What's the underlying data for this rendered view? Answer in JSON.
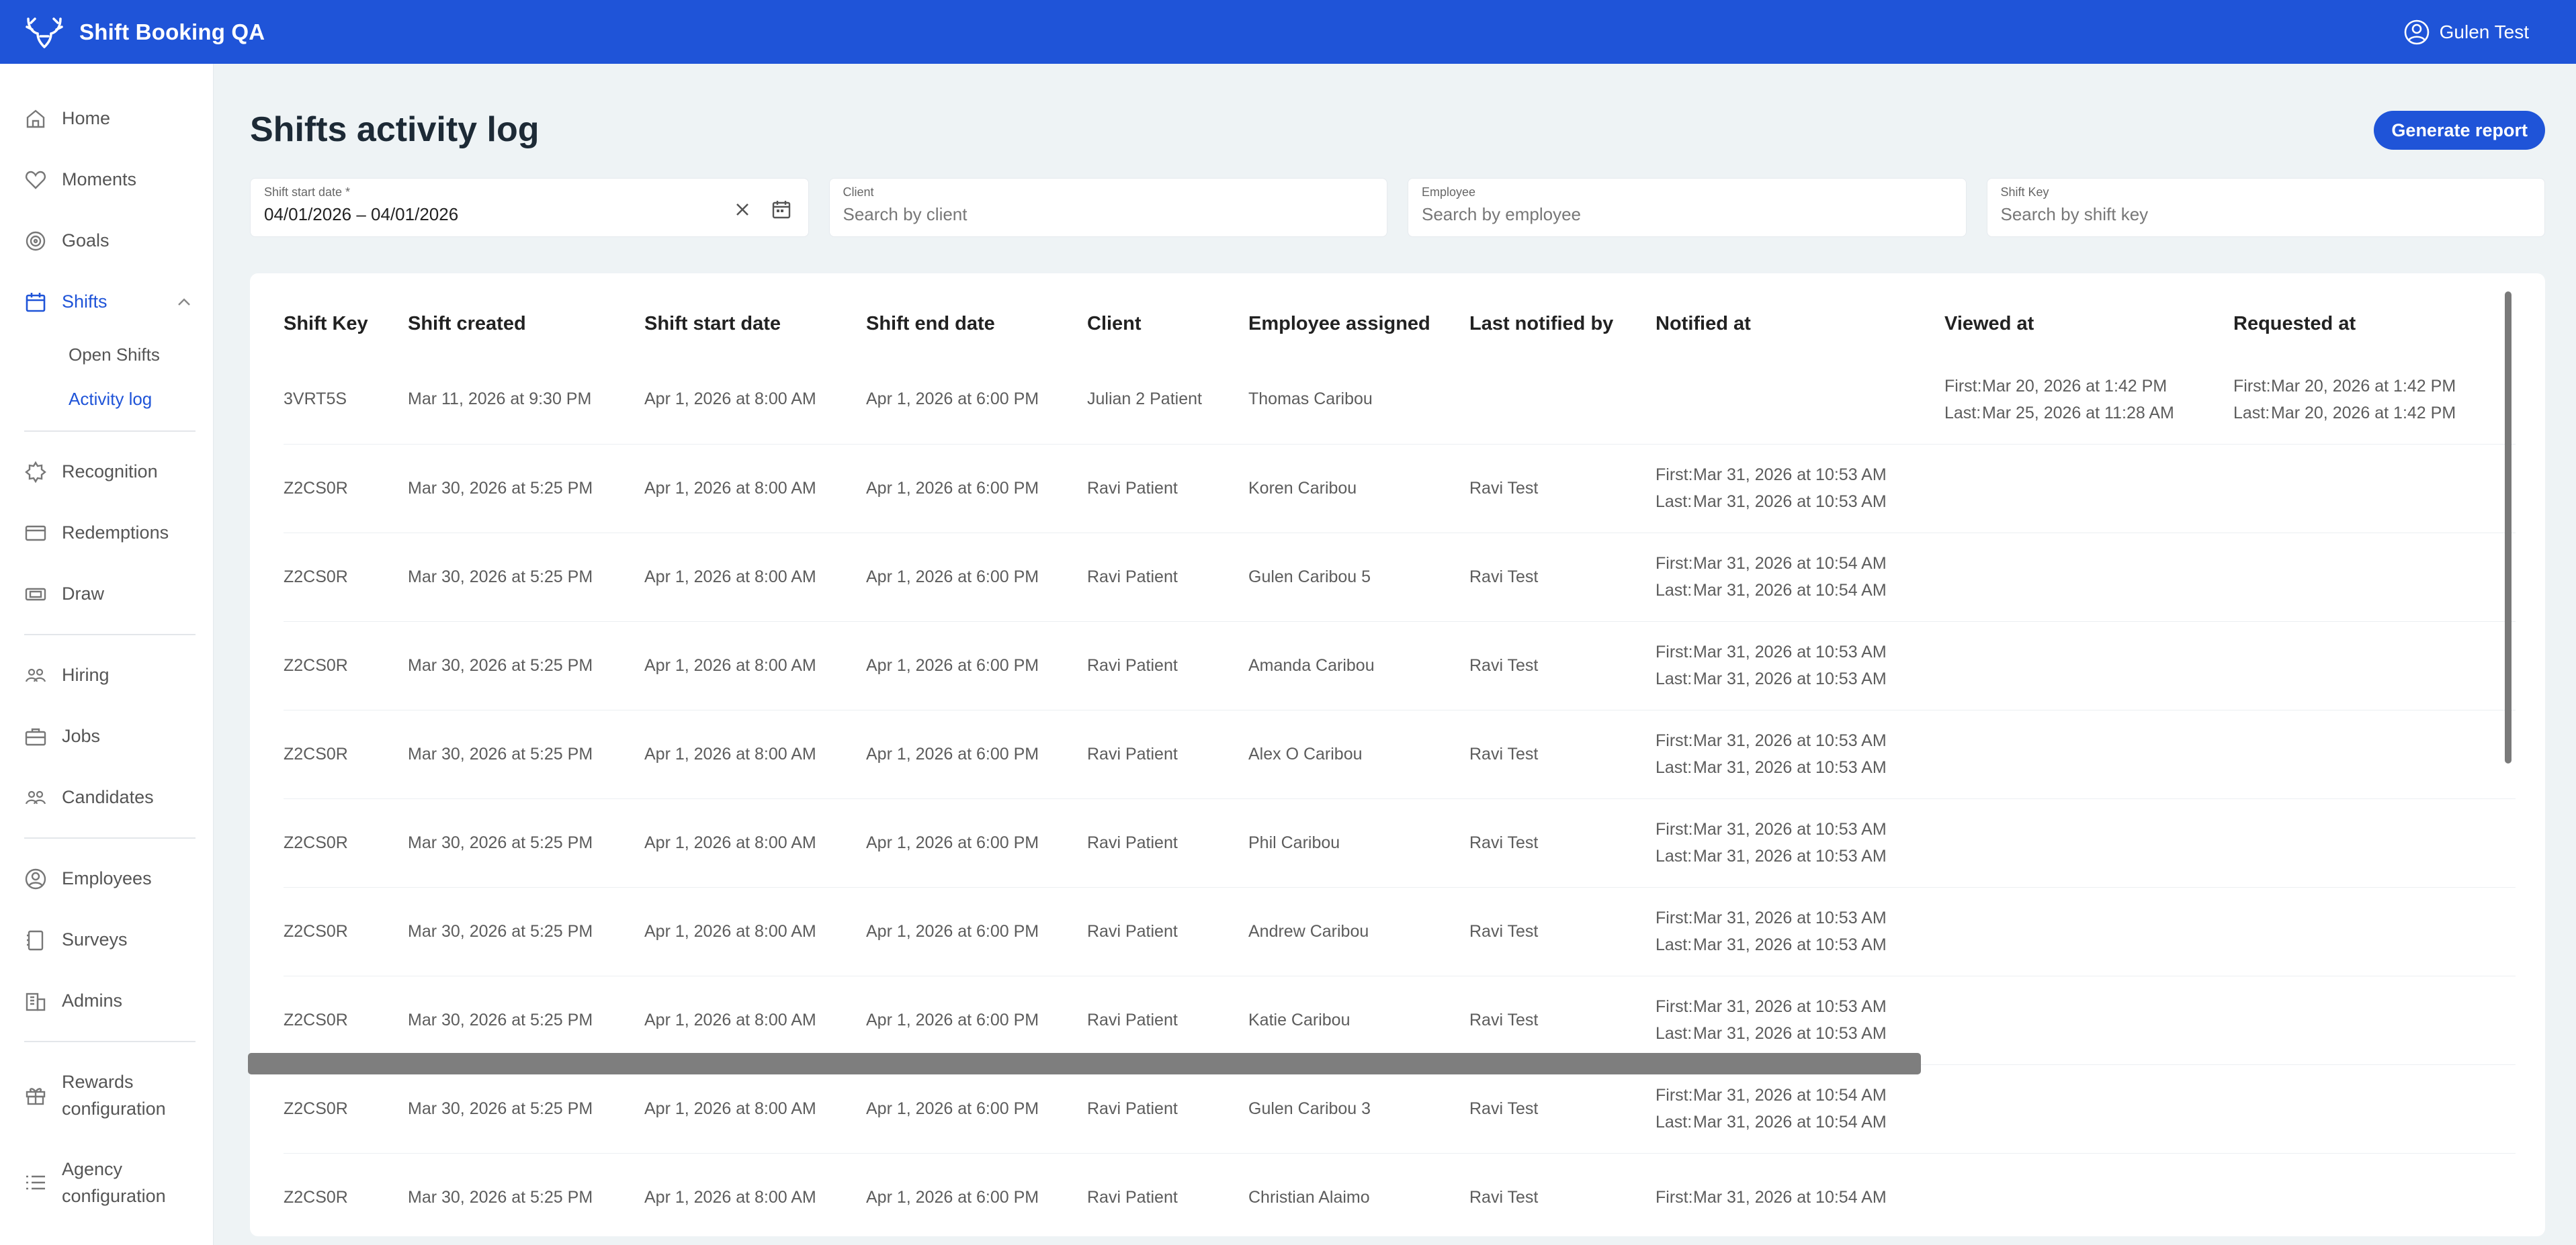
{
  "app": {
    "title": "Shift Booking QA",
    "user": "Gulen Test"
  },
  "sidebar": {
    "items": [
      {
        "label": "Home",
        "icon": "home-icon"
      },
      {
        "label": "Moments",
        "icon": "heart-icon"
      },
      {
        "label": "Goals",
        "icon": "target-icon"
      },
      {
        "label": "Shifts",
        "icon": "calendar-icon"
      },
      {
        "label": "Open Shifts"
      },
      {
        "label": "Activity log"
      },
      {
        "label": "Recognition",
        "icon": "badge-icon"
      },
      {
        "label": "Redemptions",
        "icon": "card-icon"
      },
      {
        "label": "Draw",
        "icon": "ticket-icon"
      },
      {
        "label": "Hiring",
        "icon": "people-icon"
      },
      {
        "label": "Jobs",
        "icon": "briefcase-icon"
      },
      {
        "label": "Candidates",
        "icon": "people-icon"
      },
      {
        "label": "Employees",
        "icon": "user-circle-icon"
      },
      {
        "label": "Surveys",
        "icon": "clipboard-icon"
      },
      {
        "label": "Admins",
        "icon": "building-icon"
      },
      {
        "label": "Rewards\nconfiguration",
        "icon": "gift-icon"
      },
      {
        "label": "Agency\nconfiguration",
        "icon": "list-icon"
      }
    ]
  },
  "page": {
    "title": "Shifts activity log",
    "generate_report": "Generate report"
  },
  "filters": {
    "date": {
      "label": "Shift start date *",
      "value": "04/01/2026 – 04/01/2026"
    },
    "client": {
      "label": "Client",
      "placeholder": "Search by client"
    },
    "employee": {
      "label": "Employee",
      "placeholder": "Search by employee"
    },
    "shift_key": {
      "label": "Shift Key",
      "placeholder": "Search by shift key"
    }
  },
  "table": {
    "columns": [
      "Shift Key",
      "Shift created",
      "Shift start date",
      "Shift end date",
      "Client",
      "Employee assigned",
      "Last notified by",
      "Notified at",
      "Viewed at",
      "Requested at"
    ],
    "first_label": "First:",
    "last_label": "Last:",
    "rows": [
      {
        "key": "3VRT5S",
        "created": "Mar 11, 2026 at 9:30 PM",
        "start": "Apr 1, 2026 at 8:00 AM",
        "end": "Apr 1, 2026 at 6:00 PM",
        "client": "Julian 2 Patient",
        "employee": "Thomas Caribou",
        "notified_by": "",
        "notified_first": "",
        "notified_last": "",
        "viewed_first": "Mar 20, 2026 at 1:42 PM",
        "viewed_last": "Mar 25, 2026 at 11:28 AM",
        "requested_first": "Mar 20, 2026 at 1:42 PM",
        "requested_last": "Mar 20, 2026 at 1:42 PM"
      },
      {
        "key": "Z2CS0R",
        "created": "Mar 30, 2026 at 5:25 PM",
        "start": "Apr 1, 2026 at 8:00 AM",
        "end": "Apr 1, 2026 at 6:00 PM",
        "client": "Ravi Patient",
        "employee": "Koren Caribou",
        "notified_by": "Ravi Test",
        "notified_first": "Mar 31, 2026 at 10:53 AM",
        "notified_last": "Mar 31, 2026 at 10:53 AM"
      },
      {
        "key": "Z2CS0R",
        "created": "Mar 30, 2026 at 5:25 PM",
        "start": "Apr 1, 2026 at 8:00 AM",
        "end": "Apr 1, 2026 at 6:00 PM",
        "client": "Ravi Patient",
        "employee": "Gulen Caribou 5",
        "notified_by": "Ravi Test",
        "notified_first": "Mar 31, 2026 at 10:54 AM",
        "notified_last": "Mar 31, 2026 at 10:54 AM"
      },
      {
        "key": "Z2CS0R",
        "created": "Mar 30, 2026 at 5:25 PM",
        "start": "Apr 1, 2026 at 8:00 AM",
        "end": "Apr 1, 2026 at 6:00 PM",
        "client": "Ravi Patient",
        "employee": "Amanda Caribou",
        "notified_by": "Ravi Test",
        "notified_first": "Mar 31, 2026 at 10:53 AM",
        "notified_last": "Mar 31, 2026 at 10:53 AM"
      },
      {
        "key": "Z2CS0R",
        "created": "Mar 30, 2026 at 5:25 PM",
        "start": "Apr 1, 2026 at 8:00 AM",
        "end": "Apr 1, 2026 at 6:00 PM",
        "client": "Ravi Patient",
        "employee": "Alex O Caribou",
        "notified_by": "Ravi Test",
        "notified_first": "Mar 31, 2026 at 10:53 AM",
        "notified_last": "Mar 31, 2026 at 10:53 AM"
      },
      {
        "key": "Z2CS0R",
        "created": "Mar 30, 2026 at 5:25 PM",
        "start": "Apr 1, 2026 at 8:00 AM",
        "end": "Apr 1, 2026 at 6:00 PM",
        "client": "Ravi Patient",
        "employee": "Phil Caribou",
        "notified_by": "Ravi Test",
        "notified_first": "Mar 31, 2026 at 10:53 AM",
        "notified_last": "Mar 31, 2026 at 10:53 AM"
      },
      {
        "key": "Z2CS0R",
        "created": "Mar 30, 2026 at 5:25 PM",
        "start": "Apr 1, 2026 at 8:00 AM",
        "end": "Apr 1, 2026 at 6:00 PM",
        "client": "Ravi Patient",
        "employee": "Andrew Caribou",
        "notified_by": "Ravi Test",
        "notified_first": "Mar 31, 2026 at 10:53 AM",
        "notified_last": "Mar 31, 2026 at 10:53 AM"
      },
      {
        "key": "Z2CS0R",
        "created": "Mar 30, 2026 at 5:25 PM",
        "start": "Apr 1, 2026 at 8:00 AM",
        "end": "Apr 1, 2026 at 6:00 PM",
        "client": "Ravi Patient",
        "employee": "Katie Caribou",
        "notified_by": "Ravi Test",
        "notified_first": "Mar 31, 2026 at 10:53 AM",
        "notified_last": "Mar 31, 2026 at 10:53 AM"
      },
      {
        "key": "Z2CS0R",
        "created": "Mar 30, 2026 at 5:25 PM",
        "start": "Apr 1, 2026 at 8:00 AM",
        "end": "Apr 1, 2026 at 6:00 PM",
        "client": "Ravi Patient",
        "employee": "Gulen Caribou 3",
        "notified_by": "Ravi Test",
        "notified_first": "Mar 31, 2026 at 10:54 AM",
        "notified_last": "Mar 31, 2026 at 10:54 AM"
      },
      {
        "key": "Z2CS0R",
        "created": "Mar 30, 2026 at 5:25 PM",
        "start": "Apr 1, 2026 at 8:00 AM",
        "end": "Apr 1, 2026 at 6:00 PM",
        "client": "Ravi Patient",
        "employee": "Christian Alaimo",
        "notified_by": "Ravi Test",
        "notified_first": "Mar 31, 2026 at 10:54 AM",
        "notified_last": ""
      }
    ]
  },
  "colors": {
    "brand": "#1f54d8",
    "background": "#eef3f5"
  }
}
